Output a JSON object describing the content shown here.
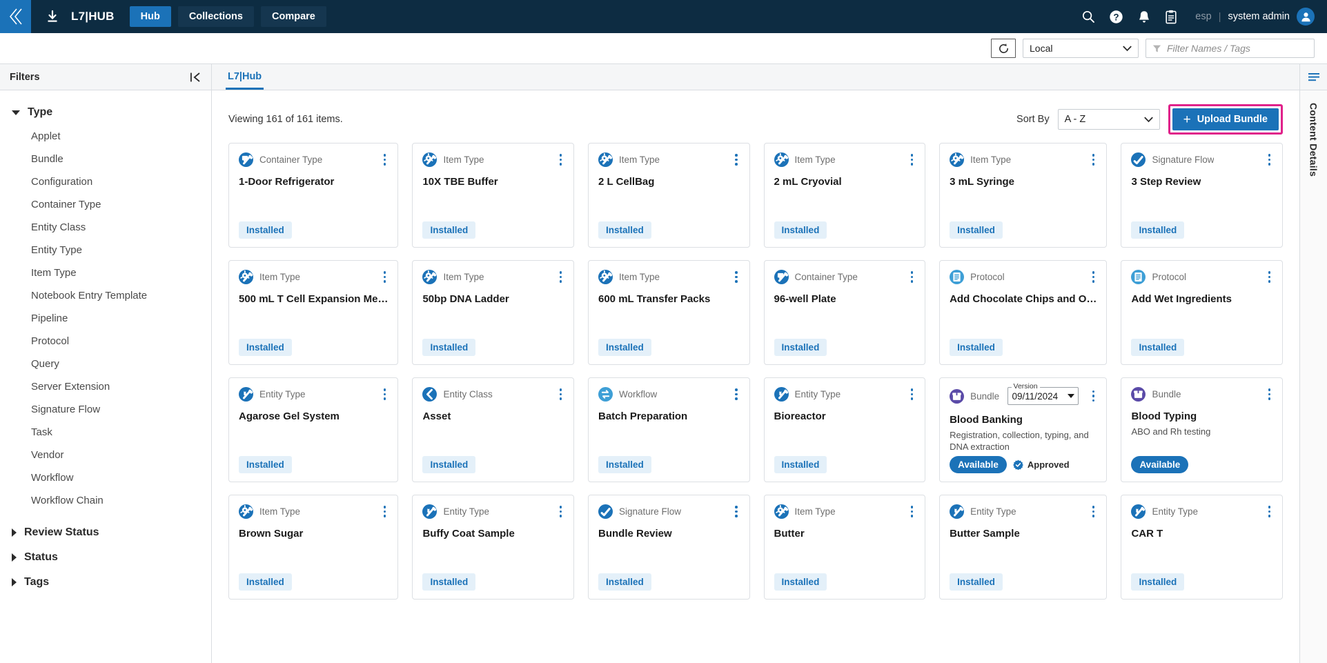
{
  "topbar": {
    "collapse_icon": "chevron-left-double-icon",
    "download_icon": "download-icon",
    "brand_title": "L7|HUB",
    "tabs": [
      {
        "label": "Hub",
        "active": true
      },
      {
        "label": "Collections",
        "active": false
      },
      {
        "label": "Compare",
        "active": false
      }
    ],
    "icons": [
      "search-icon",
      "help-icon",
      "bell-icon",
      "clipboard-icon"
    ],
    "esp_label": "esp",
    "separator": "|",
    "user_name": "system admin",
    "avatar_icon": "user-avatar-icon"
  },
  "subbar": {
    "refresh_icon": "refresh-icon",
    "environment_value": "Local",
    "filter_icon": "funnel-icon",
    "filter_placeholder": "Filter Names / Tags",
    "filter_value": ""
  },
  "sidebar": {
    "title": "Filters",
    "collapse_icon": "collapse-panel-icon",
    "groups": [
      {
        "label": "Type",
        "expanded": true,
        "items": [
          "Applet",
          "Bundle",
          "Configuration",
          "Container Type",
          "Entity Class",
          "Entity Type",
          "Item Type",
          "Notebook Entry Template",
          "Pipeline",
          "Protocol",
          "Query",
          "Server Extension",
          "Signature Flow",
          "Task",
          "Vendor",
          "Workflow",
          "Workflow Chain"
        ]
      },
      {
        "label": "Review Status",
        "expanded": false,
        "items": []
      },
      {
        "label": "Status",
        "expanded": false,
        "items": []
      },
      {
        "label": "Tags",
        "expanded": false,
        "items": []
      }
    ]
  },
  "main": {
    "tab_label": "L7|Hub",
    "viewing_text": "Viewing 161 of 161 items.",
    "sort_label": "Sort By",
    "sort_value": "A - Z",
    "upload_button": "+ Upload Bundle",
    "upload_button_label": "Upload Bundle",
    "upload_plus": "+",
    "upload_highlight_color": "#e0218a",
    "accent_color": "#1b72b8"
  },
  "right_rail": {
    "menu_icon": "list-lines-icon",
    "label": "Content Details"
  },
  "cards": [
    {
      "type": "Container Type",
      "icon": "container-type-icon",
      "icon_color": "#1b72b8",
      "title": "1-Door Refrigerator",
      "desc": "",
      "status": "Installed",
      "status_kind": "installed"
    },
    {
      "type": "Item Type",
      "icon": "item-type-icon",
      "icon_color": "#1b72b8",
      "title": "10X TBE Buffer",
      "desc": "",
      "status": "Installed",
      "status_kind": "installed"
    },
    {
      "type": "Item Type",
      "icon": "item-type-icon",
      "icon_color": "#1b72b8",
      "title": "2 L CellBag",
      "desc": "",
      "status": "Installed",
      "status_kind": "installed"
    },
    {
      "type": "Item Type",
      "icon": "item-type-icon",
      "icon_color": "#1b72b8",
      "title": "2 mL Cryovial",
      "desc": "",
      "status": "Installed",
      "status_kind": "installed"
    },
    {
      "type": "Item Type",
      "icon": "item-type-icon",
      "icon_color": "#1b72b8",
      "title": "3 mL Syringe",
      "desc": "",
      "status": "Installed",
      "status_kind": "installed"
    },
    {
      "type": "Signature Flow",
      "icon": "signature-flow-icon",
      "icon_color": "#1b72b8",
      "title": "3 Step Review",
      "desc": "",
      "status": "Installed",
      "status_kind": "installed"
    },
    {
      "type": "Item Type",
      "icon": "item-type-icon",
      "icon_color": "#1b72b8",
      "title": "500 mL T Cell Expansion Me…",
      "desc": "",
      "status": "Installed",
      "status_kind": "installed"
    },
    {
      "type": "Item Type",
      "icon": "item-type-icon",
      "icon_color": "#1b72b8",
      "title": "50bp DNA Ladder",
      "desc": "",
      "status": "Installed",
      "status_kind": "installed"
    },
    {
      "type": "Item Type",
      "icon": "item-type-icon",
      "icon_color": "#1b72b8",
      "title": "600 mL Transfer Packs",
      "desc": "",
      "status": "Installed",
      "status_kind": "installed"
    },
    {
      "type": "Container Type",
      "icon": "container-type-icon",
      "icon_color": "#1b72b8",
      "title": "96-well Plate",
      "desc": "",
      "status": "Installed",
      "status_kind": "installed"
    },
    {
      "type": "Protocol",
      "icon": "protocol-icon",
      "icon_color": "#3e9fd6",
      "title": "Add Chocolate Chips and O…",
      "desc": "",
      "status": "Installed",
      "status_kind": "installed"
    },
    {
      "type": "Protocol",
      "icon": "protocol-icon",
      "icon_color": "#3e9fd6",
      "title": "Add Wet Ingredients",
      "desc": "",
      "status": "Installed",
      "status_kind": "installed"
    },
    {
      "type": "Entity Type",
      "icon": "entity-type-icon",
      "icon_color": "#1b72b8",
      "title": "Agarose Gel System",
      "desc": "",
      "status": "Installed",
      "status_kind": "installed"
    },
    {
      "type": "Entity Class",
      "icon": "entity-class-icon",
      "icon_color": "#1b72b8",
      "title": "Asset",
      "desc": "",
      "status": "Installed",
      "status_kind": "installed"
    },
    {
      "type": "Workflow",
      "icon": "workflow-icon",
      "icon_color": "#3e9fd6",
      "title": "Batch Preparation",
      "desc": "",
      "status": "Installed",
      "status_kind": "installed"
    },
    {
      "type": "Entity Type",
      "icon": "entity-type-icon",
      "icon_color": "#1b72b8",
      "title": "Bioreactor",
      "desc": "",
      "status": "Installed",
      "status_kind": "installed"
    },
    {
      "type": "Bundle",
      "icon": "bundle-icon",
      "icon_color": "#5b4ba8",
      "title": "Blood Banking",
      "desc": "Registration, collection, typing, and DNA extraction",
      "status": "Available",
      "status_kind": "available",
      "version_legend": "Version",
      "version_value": "09/11/2024",
      "approved_label": "Approved",
      "approved_icon": "approved-badge-icon"
    },
    {
      "type": "Bundle",
      "icon": "bundle-icon",
      "icon_color": "#5b4ba8",
      "title": "Blood Typing",
      "desc": "ABO and Rh testing",
      "status": "Available",
      "status_kind": "available"
    },
    {
      "type": "Item Type",
      "icon": "item-type-icon",
      "icon_color": "#1b72b8",
      "title": "Brown Sugar",
      "desc": "",
      "status": "Installed",
      "status_kind": "installed"
    },
    {
      "type": "Entity Type",
      "icon": "entity-type-icon",
      "icon_color": "#1b72b8",
      "title": "Buffy Coat Sample",
      "desc": "",
      "status": "Installed",
      "status_kind": "installed"
    },
    {
      "type": "Signature Flow",
      "icon": "signature-flow-icon",
      "icon_color": "#1b72b8",
      "title": "Bundle Review",
      "desc": "",
      "status": "Installed",
      "status_kind": "installed"
    },
    {
      "type": "Item Type",
      "icon": "item-type-icon",
      "icon_color": "#1b72b8",
      "title": "Butter",
      "desc": "",
      "status": "Installed",
      "status_kind": "installed"
    },
    {
      "type": "Entity Type",
      "icon": "entity-type-icon",
      "icon_color": "#1b72b8",
      "title": "Butter Sample",
      "desc": "",
      "status": "Installed",
      "status_kind": "installed"
    },
    {
      "type": "Entity Type",
      "icon": "entity-type-icon",
      "icon_color": "#1b72b8",
      "title": "CAR T",
      "desc": "",
      "status": "Installed",
      "status_kind": "installed"
    }
  ]
}
